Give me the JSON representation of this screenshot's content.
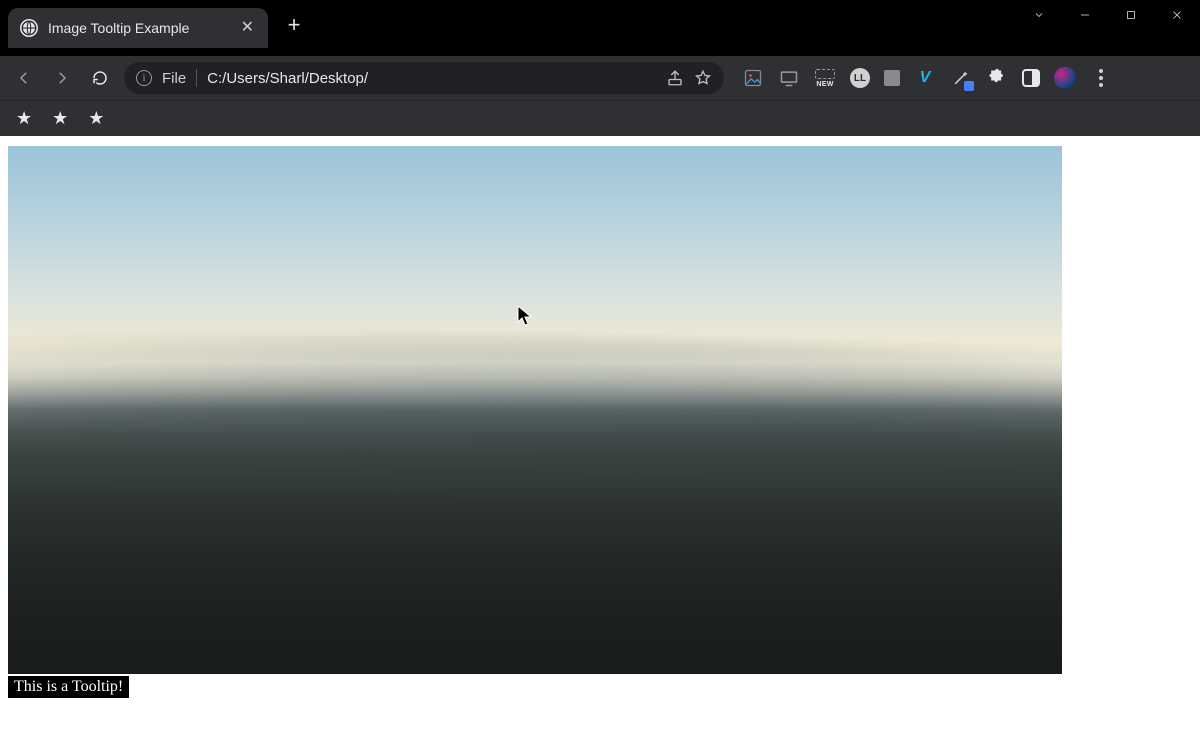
{
  "window": {
    "tab_title": "Image Tooltip Example",
    "new_tab_label": "+"
  },
  "toolbar": {
    "scheme_label": "File",
    "url": "C:/Users/Sharl/Desktop/",
    "extensions": {
      "new_badge_label": "NEW",
      "ll_label": "LL",
      "vimeo_label": "V"
    },
    "icons": {
      "back": "back-icon",
      "forward": "forward-icon",
      "reload": "reload-icon",
      "info": "info-icon",
      "share": "share-icon",
      "star": "star-icon",
      "images_ext": "image-extension-icon",
      "cast": "cast-icon",
      "new_badge": "new-badge-icon",
      "ll": "ll-extension-icon",
      "gray_block": "gray-block-extension-icon",
      "vimeo": "vimeo-icon",
      "wand": "wand-extension-icon",
      "puzzle": "extensions-icon",
      "side_panel": "side-panel-icon",
      "avatar": "profile-avatar-icon",
      "menu": "chrome-menu-icon",
      "tab_search": "tab-search-icon",
      "minimize": "minimize-icon",
      "maximize": "maximize-icon",
      "close_window": "close-window-icon",
      "close_tab": "close-tab-icon",
      "favicon": "page-favicon-icon",
      "new_tab": "new-tab-icon",
      "bookmark_star": "bookmark-star-icon"
    }
  },
  "page": {
    "hero_alt": "Aerial landscape photograph of hazy mountain ranges under a pale sky",
    "tooltip_text": "This is a Tooltip!"
  }
}
